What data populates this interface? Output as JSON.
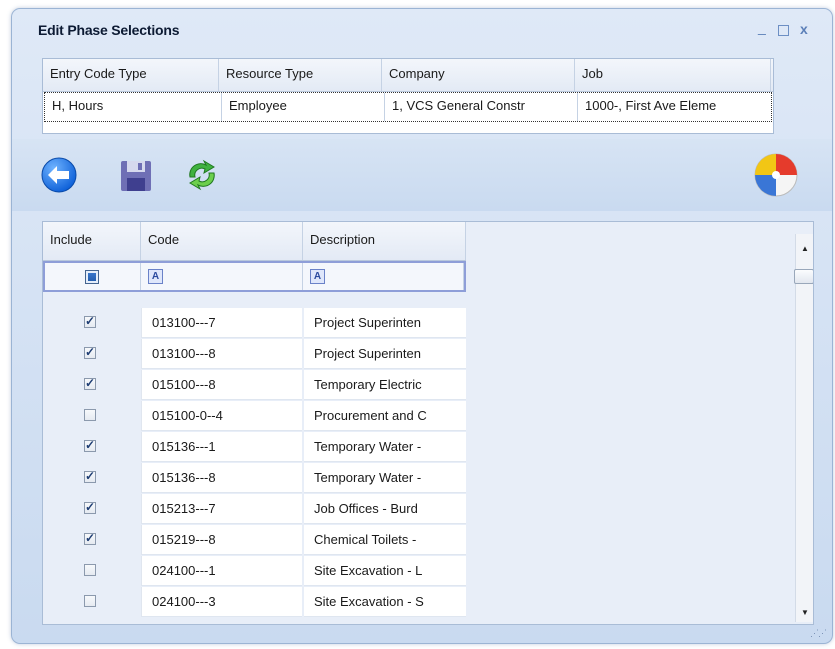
{
  "window": {
    "title": "Edit Phase Selections",
    "controls": {
      "minimize": "_",
      "maximize": "□",
      "close": "x"
    }
  },
  "header_grid": {
    "columns": [
      "Entry Code Type",
      "Resource Type",
      "Company",
      "Job"
    ],
    "row": [
      "H, Hours",
      "Employee",
      "1, VCS General Constr",
      "1000-, First Ave Eleme"
    ]
  },
  "toolbar": {
    "icons": [
      "back-arrow-icon",
      "save-icon",
      "refresh-icon",
      "beach-ball-icon"
    ],
    "accent": "#1c6fe0"
  },
  "phase_grid": {
    "columns": [
      "Include",
      "Code",
      "Description"
    ],
    "filter": {
      "include_all": true,
      "code_filter_icon": "A",
      "description_filter_icon": "A"
    },
    "rows": [
      {
        "include": true,
        "code": "013100---7",
        "description": "Project Superinten"
      },
      {
        "include": true,
        "code": "013100---8",
        "description": "Project Superinten"
      },
      {
        "include": true,
        "code": "015100---8",
        "description": "Temporary Electric"
      },
      {
        "include": false,
        "code": "015100-0--4",
        "description": "Procurement and C"
      },
      {
        "include": true,
        "code": "015136---1",
        "description": "Temporary Water -"
      },
      {
        "include": true,
        "code": "015136---8",
        "description": "Temporary Water -"
      },
      {
        "include": true,
        "code": "015213---7",
        "description": "Job Offices - Burd"
      },
      {
        "include": true,
        "code": "015219---8",
        "description": "Chemical Toilets -"
      },
      {
        "include": false,
        "code": "024100---1",
        "description": "Site Excavation - L"
      },
      {
        "include": false,
        "code": "024100---3",
        "description": "Site Excavation - S"
      }
    ]
  }
}
